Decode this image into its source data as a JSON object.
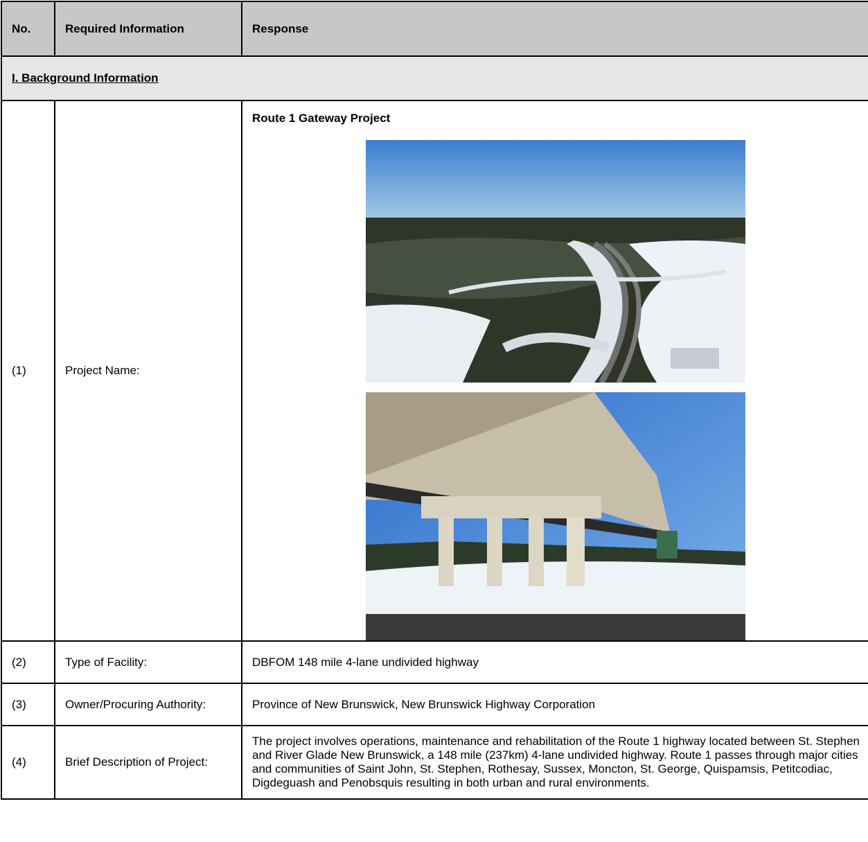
{
  "header": {
    "col_no": "No.",
    "col_required": "Required Information",
    "col_response": "Response"
  },
  "section": {
    "title": "I. Background Information"
  },
  "rows": [
    {
      "no": "(1)",
      "label": "Project Name:",
      "response": "Route 1 Gateway Project"
    },
    {
      "no": "(2)",
      "label": "Type of Facility:",
      "response": "DBFOM 148 mile 4-lane undivided highway"
    },
    {
      "no": "(3)",
      "label": "Owner/Procuring Authority:",
      "response": "Province of New Brunswick, New Brunswick Highway Corporation"
    },
    {
      "no": "(4)",
      "label": "Brief Description of Project:",
      "response": "The project involves operations, maintenance and rehabilitation of the Route 1 highway located between St. Stephen and River Glade New Brunswick, a 148 mile (237km) 4-lane undivided highway. Route 1 passes through major cities and communities of Saint John, St. Stephen, Rothesay, Sussex, Moncton, St. George, Quispamsis, Petitcodiac, Digdeguash and Penobsquis resulting in both urban and rural environments."
    }
  ],
  "colors": {
    "header_bg": "#c7c7c7",
    "section_bg": "#e6e6e6",
    "border": "#000000"
  }
}
